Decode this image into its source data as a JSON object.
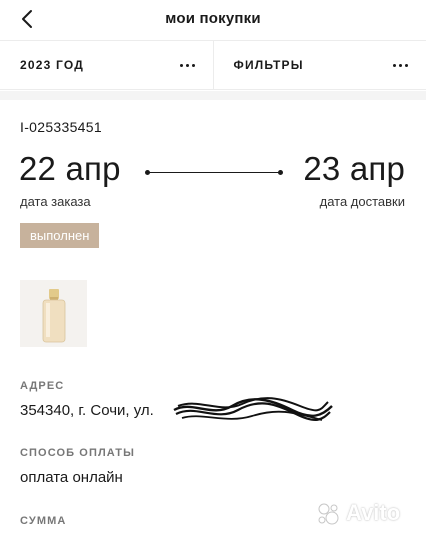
{
  "header": {
    "title": "мои покупки",
    "back_icon": "chevron-left-icon"
  },
  "filters": {
    "year_label": "2023 ГОД",
    "filters_label": "ФИЛЬТРЫ",
    "more_icon": "more-horizontal-icon"
  },
  "order": {
    "id": "I-025335451",
    "order_date": "22 апр",
    "delivery_date": "23 апр",
    "order_date_caption": "дата заказа",
    "delivery_date_caption": "дата доставки",
    "status": "выполнен",
    "product_icon": "foundation-bottle-image"
  },
  "details": {
    "address_label": "АДРЕС",
    "address_value": "354340, г. Сочи, ул.",
    "payment_label": "СПОСОБ ОПЛАТЫ",
    "payment_value": "оплата онлайн",
    "total_label": "СУММА"
  },
  "watermark": {
    "text": "Avito"
  },
  "colors": {
    "status_badge": "#c7b29c",
    "band": "#f4f4f4",
    "label": "#777777"
  }
}
